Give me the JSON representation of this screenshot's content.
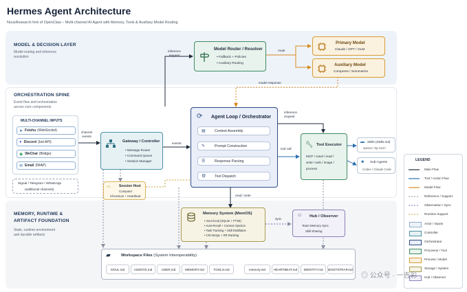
{
  "title": "Hermes Agent Architecture",
  "subtitle": "NousResearch fork of OpenClaw – Multi-channel AI Agent with Memory, Tools & Auxiliary Model Routing",
  "sections": {
    "model": {
      "title": "MODEL & DECISION LAYER",
      "desc1": "Model routing and inference",
      "desc2": "resolution"
    },
    "orch": {
      "title": "ORCHESTRATION SPINE",
      "desc1": "Event flow and orchestration",
      "desc2": "across core components"
    },
    "memory": {
      "title1": "MEMORY, RUNTIME &",
      "title2": "ARTIFACT FOUNDATION",
      "desc1": "State, runtime environment",
      "desc2": "and durable artifacts"
    }
  },
  "channels": {
    "title": "MULTI-CHANNEL INPUTS",
    "items": [
      {
        "name": "Feishu",
        "detail": "(WebSocket)"
      },
      {
        "name": "Discord",
        "detail": "(bot API)"
      },
      {
        "name": "WeChat",
        "detail": "(Bridge)"
      },
      {
        "name": "Email",
        "detail": "(IMAP)"
      }
    ],
    "extra1": "Signal / Telegram / WhatsApp",
    "extra2": "(additional channels)"
  },
  "router": {
    "title": "Model Router / Resolver",
    "items": [
      "Fallback + Policies",
      "Auxiliary Routing"
    ]
  },
  "primary": {
    "title": "Primary Model",
    "sub": "Claude / GPT / GLM"
  },
  "auxiliary": {
    "title": "Auxiliary Model",
    "sub": "Compress / Summarize"
  },
  "agent": {
    "title": "Agent Loop / Orchestrator",
    "items": [
      "Context Assembly",
      "Prompt Construction",
      "Response Parsing",
      "Tool Dispatch"
    ]
  },
  "gateway": {
    "title": "Gateway / Controller",
    "items": [
      "Message Router",
      "Command Queue",
      "Session Manager"
    ]
  },
  "session": {
    "title": "Session Host",
    "l1": "Computer",
    "l2": "Chromium + Heartbeat"
  },
  "tool": {
    "title": "Tool Executor",
    "l1": "MCP / crawl / read /",
    "l2": "write / web / image /",
    "l3": "process"
  },
  "skills": {
    "title": "Skills (Skills.md)",
    "sub": "openai / zip-cord /"
  },
  "subagents": {
    "title": "Sub-Agents",
    "sub": "Codex / Claude Code"
  },
  "memory_sys": {
    "title": "Memory System (MemOS)",
    "items": [
      "mem-local (SQLite + FTS5)",
      "Auto-Recall + Context Injection",
      "Task Tracking + Skill Distillation",
      "CRI Merge + RR Ranking"
    ]
  },
  "hub": {
    "title": "Hub / Observer",
    "l1": "Team Memory Sync",
    "l2": "Skill Sharing"
  },
  "workspace": {
    "title": "Workspace Files",
    "subtitle": "(System Interoperability)",
    "files": [
      "SOUL.md",
      "AGENTS.md",
      "USER.md",
      "MEMORY.md",
      "TOOLS.md",
      "memory.md",
      "HEARTBEAT.md",
      "IDENTITY.md",
      "BOOTSTRAP.md"
    ]
  },
  "edges": {
    "inference_request": [
      "inference",
      "request"
    ],
    "route": "route",
    "model_response": "model response",
    "channel_events": [
      "channel",
      "events"
    ],
    "events": "events",
    "inference_request2": [
      "inference",
      "request"
    ],
    "tool_call": "tool call",
    "read_write": "read / write",
    "sync": "sync"
  },
  "legend": {
    "title": "LEGEND",
    "lines": [
      "Main Flow",
      "Tool / Action Flow",
      "Model Flow",
      "Reference / Support",
      "Observation / Sync",
      "Runtime Support"
    ],
    "swatches": [
      "Actor / Inputs",
      "Controller",
      "Orchestrator",
      "Processor / Tool",
      "Process / Model",
      "Storage / System",
      "Hub / Observer"
    ]
  },
  "watermark": "公众号 · 一吉彩",
  "colors": {
    "main": "#1f2a3a",
    "tool": "#2a6fb0",
    "model": "#d98a1f",
    "support": "#8a8fa0",
    "sync": "#7b6fb0",
    "runtime": "#c9a23a"
  }
}
